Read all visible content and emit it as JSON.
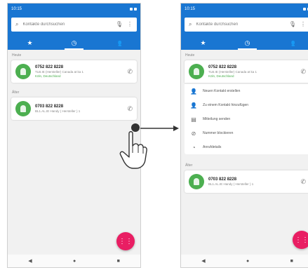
{
  "status": {
    "time": "10:15",
    "signal": "LTE"
  },
  "search": {
    "placeholder": "Kontakte durchsuchen"
  },
  "tabs": [
    "★",
    "◷",
    "👥"
  ],
  "left": {
    "sections": [
      {
        "label": "Heute",
        "contact": {
          "number": "0752 822 8228",
          "detail": "TLB.IE (Hersteller) Canada at ka 1",
          "location": "Köln, Deutschland"
        }
      },
      {
        "label": "Älter",
        "contact": {
          "number": "0703 822 8228",
          "detail": "BL1.AL.IE Handy ( Hersteller ) 1",
          "location": ""
        }
      }
    ]
  },
  "right": {
    "section_label": "Heute",
    "contact": {
      "number": "0752 822 8228",
      "detail": "TLB.IE (Hersteller) Canada at ka 1",
      "location": "Köln, Deutschland"
    },
    "menu": [
      {
        "icon": "person-add-icon",
        "glyph": "👤",
        "label": "Neuen Kontakt erstellen"
      },
      {
        "icon": "person-icon",
        "glyph": "👤",
        "label": "Zu einem Kontakt hinzufügen"
      },
      {
        "icon": "message-icon",
        "glyph": "▤",
        "label": "Mitteilung senden"
      },
      {
        "icon": "block-icon",
        "glyph": "⊘",
        "label": "Nummer blockieren"
      },
      {
        "icon": "history-icon",
        "glyph": "◔",
        "label": "Anrufdetails"
      }
    ],
    "older_label": "Älter",
    "older_contact": {
      "number": "0703 822 8228",
      "detail": "BL1.AL.IE Handy ( Hersteller ) 1"
    }
  },
  "navbar": [
    "◀",
    "●",
    "■"
  ],
  "fab_glyph": "⋮⋮"
}
